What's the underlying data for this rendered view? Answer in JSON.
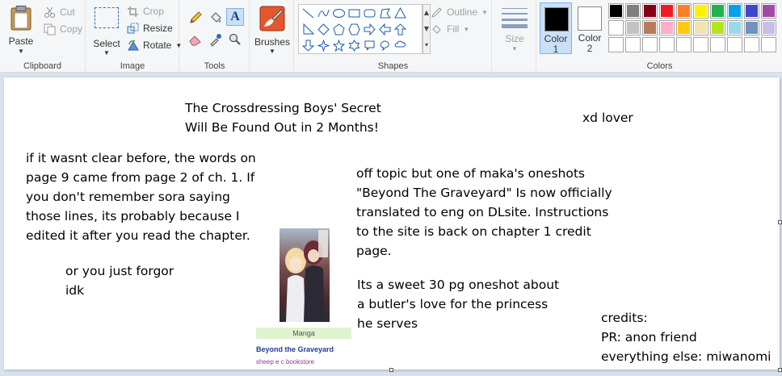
{
  "ribbon": {
    "clipboard": {
      "label": "Clipboard",
      "paste": "Paste",
      "cut": "Cut",
      "copy": "Copy"
    },
    "image": {
      "label": "Image",
      "select": "Select",
      "crop": "Crop",
      "resize": "Resize",
      "rotate": "Rotate"
    },
    "tools": {
      "label": "Tools"
    },
    "brushes": {
      "label": "Brushes"
    },
    "shapes": {
      "label": "Shapes",
      "outline": "Outline",
      "fill": "Fill"
    },
    "size": {
      "label": "Size"
    },
    "colors": {
      "label": "Colors",
      "color1_label": "Color",
      "color1_num": "1",
      "color2_label": "Color",
      "color2_num": "2",
      "color1_value": "#000000",
      "color2_value": "#ffffff",
      "palette_row1": [
        "#000000",
        "#7f7f7f",
        "#880015",
        "#ed1c24",
        "#ff7f27",
        "#fff200",
        "#22b14c",
        "#00a2e8",
        "#3f48cc",
        "#a349a4"
      ],
      "palette_row2": [
        "#ffffff",
        "#c3c3c3",
        "#b97a57",
        "#ffaec9",
        "#ffc90e",
        "#efe4b0",
        "#b5e61d",
        "#99d9ea",
        "#7092be",
        "#c8bfe7"
      ],
      "palette_row3": [
        "#ffffff",
        "#ffffff",
        "#ffffff",
        "#ffffff",
        "#ffffff",
        "#ffffff",
        "#ffffff",
        "#ffffff",
        "#ffffff",
        "#ffffff"
      ]
    }
  },
  "canvas": {
    "title_line1": "The Crossdressing Boys' Secret",
    "title_line2": "Will Be Found Out in 2 Months!",
    "xd_lover": "xd lover",
    "note_lines": [
      "if it wasnt clear before, the words on",
      "page 9 came from page 2 of ch. 1. If",
      "you don't remember sora saying",
      "those lines, its probably because I",
      "edited it after you read the chapter."
    ],
    "forgor_line1": "or you just forgor",
    "forgor_line2": "idk",
    "offtopic_lines": [
      "off topic but one of maka's oneshots",
      "\"Beyond The Graveyard\" Is now officially",
      "translated to eng on DLsite. Instructions",
      "to the site is back on chapter 1 credit",
      "page."
    ],
    "oneshot_lines": [
      "Its a sweet 30 pg oneshot about",
      "a butler's love for the princess",
      "he serves"
    ],
    "credits_lines": [
      "credits:",
      "PR: anon friend",
      "everything else: miwanomi"
    ],
    "manga_tag": "Manga",
    "manga_title": "Beyond the Graveyard",
    "manga_store": "sheep e c bookstore"
  }
}
